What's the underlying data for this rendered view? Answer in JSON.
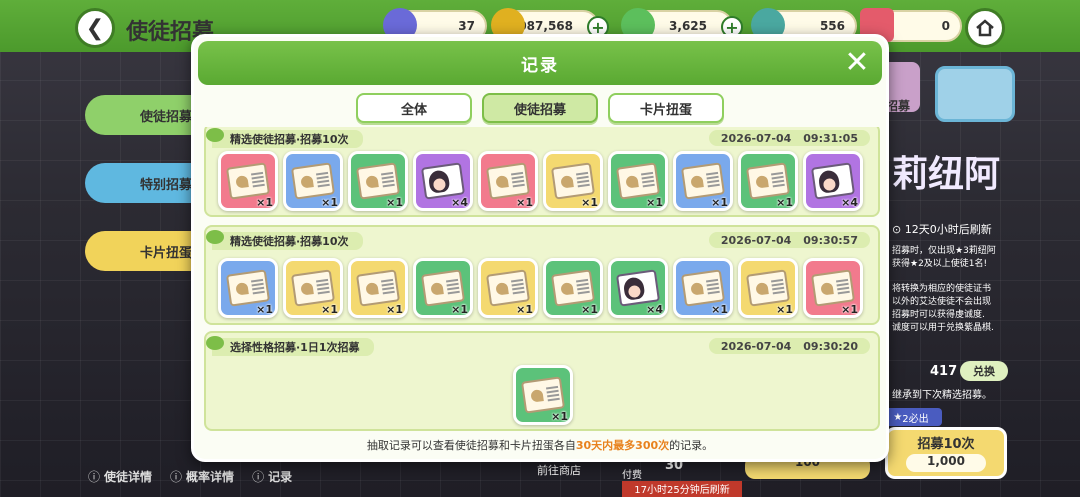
{
  "header": {
    "title": "使徒招募",
    "back_icon": "back-arrow-icon",
    "home_icon": "home-icon"
  },
  "currencies": [
    {
      "value": "37",
      "icon": "crystal-icon",
      "color": "#6a6ad8"
    },
    {
      "value": "1,087,568",
      "icon": "gold-coin-icon",
      "color": "#e0b020"
    },
    {
      "value": "3,625",
      "icon": "green-gem-icon",
      "color": "#5cbf5c"
    },
    {
      "value": "556",
      "icon": "gem-cluster-icon",
      "color": "#4aa8a0"
    },
    {
      "value": "0",
      "icon": "ticket-icon",
      "color": "#e45b6b"
    }
  ],
  "side_tabs": [
    "使徒招募",
    "特别招募",
    "卡片扭蛋"
  ],
  "bottom_links": [
    "使徒详情",
    "概率详情",
    "记录"
  ],
  "background_right": {
    "banner_text": "莉纽阿",
    "refresh": "12天0小时后刷新",
    "points": "417",
    "exchange": "兑换",
    "carry": "继承到下次精选招募。",
    "guarantee": "2必出",
    "recruit10": "招募10次",
    "cost_small": "100",
    "cost_big": "1,000",
    "shop": "前往商店",
    "paid": "付费",
    "paid_value": "30",
    "timer": "17小时25分钟后刷新",
    "right_tab": "招募",
    "lines": [
      "招募时，仅出现★3莉纽阿",
      "获得★2及以上使徒1名!",
      "将转换为相应的使徒证书",
      "以外的艾达使徒不会出现",
      "招募时可以获得虔诚度.",
      "诚度可以用于兑换紫晶棋."
    ]
  },
  "modal": {
    "title": "记录",
    "tabs": [
      {
        "label": "全体",
        "active": false
      },
      {
        "label": "使徒招募",
        "active": true
      },
      {
        "label": "卡片扭蛋",
        "active": false
      }
    ],
    "records": [
      {
        "title": "精选使徒招募·招募10次",
        "date": "2026-07-04",
        "time": "09:31:05",
        "cards": [
          {
            "color": "pink",
            "kind": "cert",
            "qty": "×1"
          },
          {
            "color": "blue",
            "kind": "cert",
            "qty": "×1"
          },
          {
            "color": "green",
            "kind": "cert",
            "qty": "×1"
          },
          {
            "color": "purple",
            "kind": "face",
            "qty": "×4"
          },
          {
            "color": "pink",
            "kind": "cert",
            "qty": "×1"
          },
          {
            "color": "yellow",
            "kind": "cert",
            "qty": "×1"
          },
          {
            "color": "green",
            "kind": "cert",
            "qty": "×1"
          },
          {
            "color": "blue",
            "kind": "cert",
            "qty": "×1"
          },
          {
            "color": "green",
            "kind": "cert",
            "qty": "×1"
          },
          {
            "color": "purple",
            "kind": "face",
            "qty": "×4"
          }
        ]
      },
      {
        "title": "精选使徒招募·招募10次",
        "date": "2026-07-04",
        "time": "09:30:57",
        "cards": [
          {
            "color": "blue",
            "kind": "cert",
            "qty": "×1"
          },
          {
            "color": "yellow",
            "kind": "cert",
            "qty": "×1"
          },
          {
            "color": "yellow",
            "kind": "cert",
            "qty": "×1"
          },
          {
            "color": "green",
            "kind": "cert",
            "qty": "×1"
          },
          {
            "color": "yellow",
            "kind": "cert",
            "qty": "×1"
          },
          {
            "color": "green",
            "kind": "cert",
            "qty": "×1"
          },
          {
            "color": "green",
            "kind": "face",
            "qty": "×4"
          },
          {
            "color": "blue",
            "kind": "cert",
            "qty": "×1"
          },
          {
            "color": "yellow",
            "kind": "cert",
            "qty": "×1"
          },
          {
            "color": "pink",
            "kind": "cert",
            "qty": "×1"
          }
        ]
      },
      {
        "title": "选择性格招募·1日1次招募",
        "date": "2026-07-04",
        "time": "09:30:20",
        "cards": [
          {
            "color": "green",
            "kind": "cert",
            "qty": "×1"
          }
        ]
      }
    ],
    "footer": {
      "pre": "抽取记录可以查看使徒招募和卡片扭蛋各自",
      "hl": "30天内最多300次",
      "post": "的记录。"
    }
  }
}
